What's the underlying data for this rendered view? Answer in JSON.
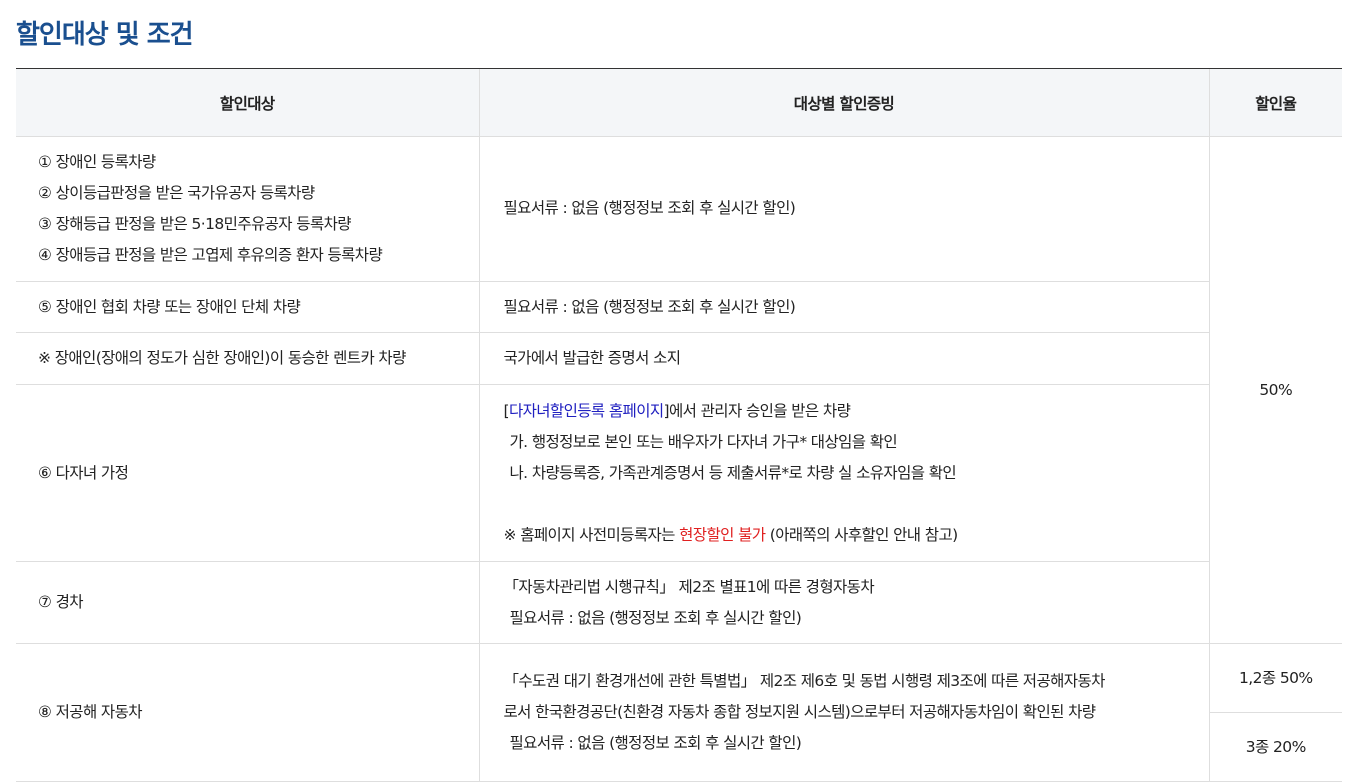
{
  "page_title": "할인대상 및 조건",
  "headers": {
    "target": "할인대상",
    "proof": "대상별 할인증빙",
    "rate": "할인율"
  },
  "rows": [
    {
      "targets": [
        "① 장애인 등록차량",
        "② 상이등급판정을 받은 국가유공자 등록차량",
        "③ 장해등급 판정을 받은 5·18민주유공자 등록차량",
        "④ 장애등급 판정을 받은 고엽제 후유의증 환자 등록차량"
      ],
      "proof": "필요서류 : 없음 (행정정보 조회 후 실시간 할인)"
    },
    {
      "targets": [
        "⑤ 장애인 협회 차량 또는 장애인 단체 차량"
      ],
      "proof": "필요서류 : 없음 (행정정보 조회 후 실시간 할인)"
    },
    {
      "targets": [
        "※ 장애인(장애의 정도가 심한 장애인)이 동승한 렌트카 차량"
      ],
      "proof": "국가에서 발급한 증명서 소지"
    },
    {
      "targets": [
        "⑥ 다자녀 가정"
      ],
      "proof_open": "[",
      "proof_link": "다자녀할인등록 홈페이지",
      "proof_rest": "]에서 관리자 승인을 받은 차량",
      "proof_a": "가. 행정정보로 본인 또는 배우자가 다자녀 가구* 대상임을 확인",
      "proof_b": "나. 차량등록증, 가족관계증명서 등 제출서류*로 차량 실 소유자임을 확인",
      "note_pre": "※ 홈페이지 사전미등록자는 ",
      "note_red": "현장할인 불가",
      "note_post": " (아래쪽의 사후할인 안내 참고)"
    },
    {
      "targets": [
        "⑦ 경차"
      ],
      "proof_1": "「자동차관리법 시행규칙」 제2조 별표1에 따른 경형자동차",
      "proof_2": "필요서류 : 없음 (행정정보 조회 후 실시간 할인)"
    },
    {
      "targets": [
        "⑧ 저공해 자동차"
      ],
      "proof_1": "「수도권 대기 환경개선에 관한 특별법」 제2조 제6호 및 동법 시행령 제3조에 따른 저공해자동차",
      "proof_2": "로서 한국환경공단(친환경 자동차 종합 정보지원 시스템)으로부터 저공해자동차임이 확인된 차량",
      "proof_3": "필요서류 : 없음 (행정정보 조회 후 실시간 할인)"
    }
  ],
  "rate_main": "50%",
  "rate_low_1": "1,2종 50%",
  "rate_low_2": "3종 20%",
  "colors": {
    "title": "#1a4f8f",
    "link": "#2020c0",
    "warning": "#e02020",
    "header_bg": "#f4f6f8"
  }
}
